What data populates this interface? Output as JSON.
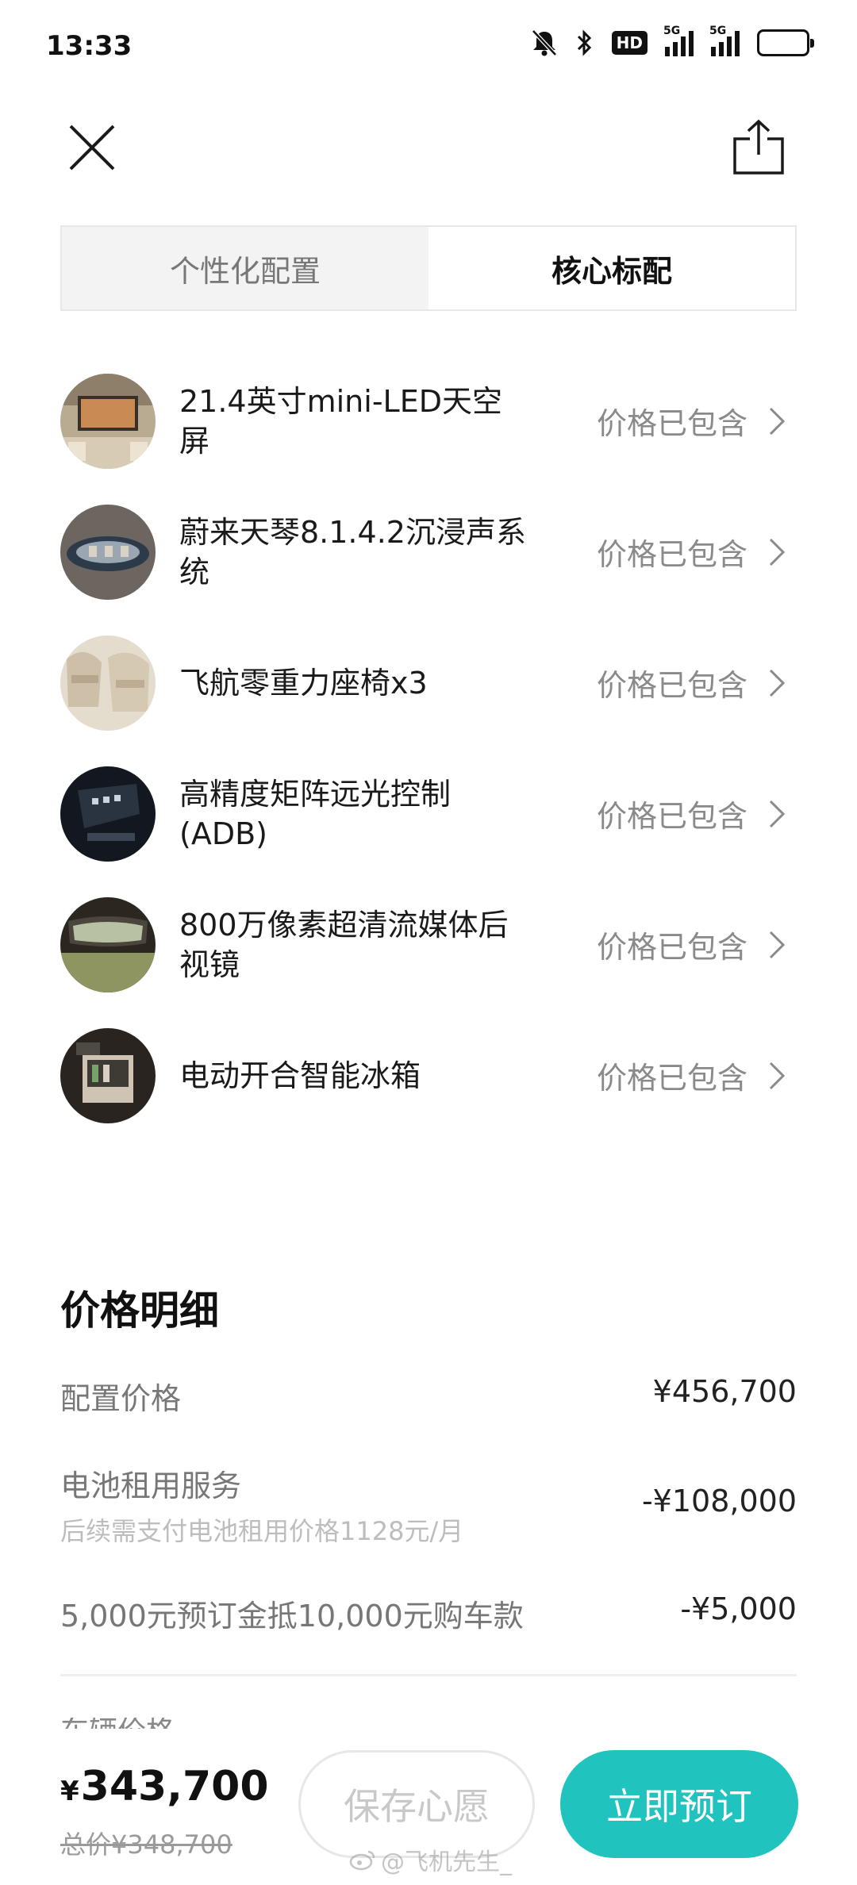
{
  "status_bar": {
    "time": "13:33",
    "hd_label": "HD",
    "signal1_label": "5G",
    "signal2_label": "5G",
    "battery_level": 0.4
  },
  "nav": {
    "close_icon": "close-icon",
    "share_icon": "share-icon"
  },
  "tabs": [
    {
      "label": "个性化配置",
      "active": false
    },
    {
      "label": "核心标配",
      "active": true
    }
  ],
  "features": [
    {
      "name": "21.4英寸mini-LED天空屏",
      "price": "价格已包含",
      "thumb": "sky-screen"
    },
    {
      "name": "蔚来天琴8.1.4.2沉浸声系统",
      "price": "价格已包含",
      "thumb": "car-audio"
    },
    {
      "name": "飞航零重力座椅x3",
      "price": "价格已包含",
      "thumb": "seats"
    },
    {
      "name": "高精度矩阵远光控制(ADB)",
      "price": "价格已包含",
      "thumb": "headlight"
    },
    {
      "name": "800万像素超清流媒体后视镜",
      "price": "价格已包含",
      "thumb": "mirror"
    },
    {
      "name": "电动开合智能冰箱",
      "price": "价格已包含",
      "thumb": "fridge"
    }
  ],
  "price_detail": {
    "title": "价格明细",
    "rows": [
      {
        "label": "配置价格",
        "sub": "",
        "value": "¥456,700"
      },
      {
        "label": "电池租用服务",
        "sub": "后续需支付电池租用价格1128元/月",
        "value": "-¥108,000"
      },
      {
        "label": "5,000元预订金抵10,000元购车款",
        "sub": "",
        "value": "-¥5,000"
      }
    ],
    "partial_next": "车辆价格"
  },
  "bottom": {
    "currency": "¥",
    "total": "343,700",
    "original": "总价¥348,700",
    "save_label": "保存心愿",
    "order_label": "立即预订"
  },
  "watermark": "@飞机先生_",
  "colors": {
    "accent": "#20c3bd",
    "text_secondary": "#8a8a8a",
    "tab_inactive_bg": "#f3f3f3"
  }
}
